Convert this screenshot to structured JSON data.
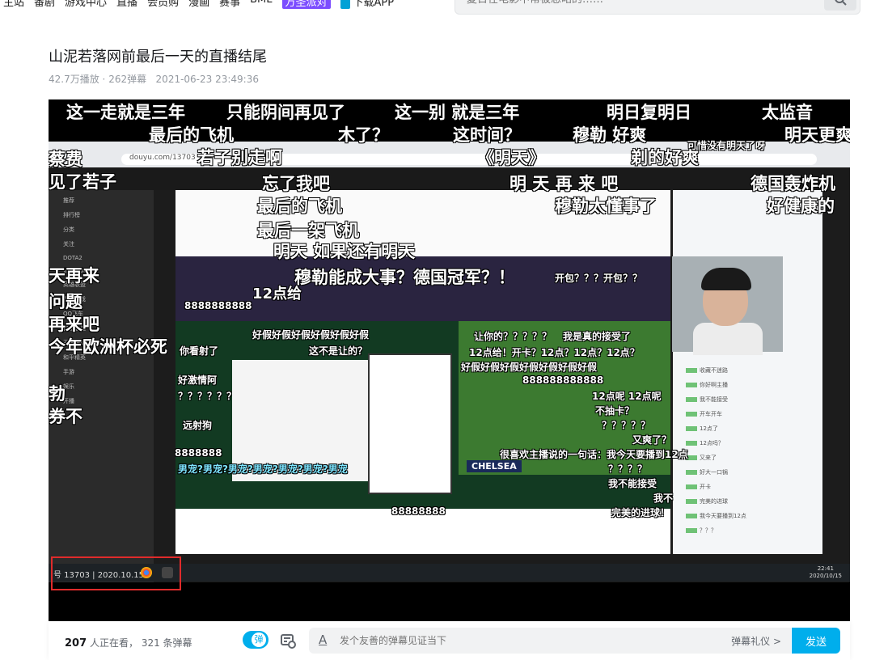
{
  "nav": {
    "items": [
      "主站",
      "番剧",
      "游戏中心",
      "直播",
      "会员购",
      "漫画",
      "赛事",
      "BML",
      "万圣派对",
      "下载APP"
    ],
    "search_placeholder": "夏日在电影中常被忽略的……"
  },
  "video": {
    "title": "山泥若落网前最后一天的直播结尾",
    "views": "42.7万播放",
    "danmaku_count": "262弹幕",
    "date": "2021-06-23 23:49:36"
  },
  "screen": {
    "url": "douyu.com/13703",
    "taskbar_text": "号 13703 | 2020.10.15",
    "clock_time": "22:41",
    "clock_date": "2020/10/15",
    "scoreboard_team": "CHELSEA",
    "sidebar_items": [
      "推荐",
      "排行榜",
      "分类",
      "关注",
      "DOTA2",
      "VALORANT",
      "英雄联盟",
      "主机游戏",
      "QQ飞车",
      "自由之战",
      "王者荣耀",
      "和平精英",
      "手游",
      "娱乐",
      "开播"
    ],
    "chat_lines": [
      "收藏不迷路",
      "你好啊主播",
      "我不能接受",
      "开车开车",
      "12点了",
      "12点吗？",
      "又来了",
      "好大一口锅",
      "开卡",
      "完美的进球",
      "我今天要播到12点",
      "？？？"
    ]
  },
  "danmaku": [
    "这一走就是三年",
    "只能阴间再见了",
    "这一别 就是三年",
    "明日复明日",
    "太监音",
    "最后的飞机",
    "木了？",
    "这时间？",
    "穆勒 好爽",
    "明天更爽",
    "若子别走啊",
    "《明天》",
    "剃的好爽",
    "可惜没有明天了呀",
    "忘了我吧",
    "明 天 再 来 吧",
    "德国轰炸机",
    "最后的飞机",
    "穆勒太懂事了",
    "好健康的",
    "最后一架飞机",
    "明天 如果还有明天",
    "穆勒能成大事？德国冠军？！",
    "开包？？？开包？？",
    "天再来",
    "问题",
    "再来吧",
    "今年欧洲杯必死",
    "好假好假好假好假好假好假",
    "12点给",
    "8888888888",
    "这不是让的？",
    "你看射了",
    "让你的？？？？？",
    "我是真的接受了",
    "12点给！开卡？12点？12点？12点？",
    "好假好假好假好假好假好假好假",
    "888888888888",
    "？？？？？？",
    "12点呢 12点呢",
    "好激情阿",
    "不抽卡？",
    "？？？？？",
    "见了若子",
    "蔡费",
    "又爽了？",
    "远射狗",
    "很喜欢主播说的一句话：我今天要播到12点",
    "男宠?男宠?男宠?男宠?男宠?男宠?男宠",
    "8888888",
    "？？？？",
    "我不能接受",
    "完美的进球！",
    "我不",
    "88888888",
    "勃",
    "券不"
  ],
  "bottom": {
    "viewers": "207",
    "viewers_text": "人正在看，",
    "danmaku_text": "321 条弹幕",
    "toggle_label": "弹",
    "input_placeholder": "发个友善的弹幕见证当下",
    "etiquette": "弹幕礼仪 >",
    "send": "发送"
  },
  "colors": {
    "accent": "#00aeec",
    "highlight_box": "#e02b2b"
  },
  "icons": {
    "search": "search-icon",
    "settings": "danmaku-settings-icon",
    "text": "text-style-icon"
  }
}
